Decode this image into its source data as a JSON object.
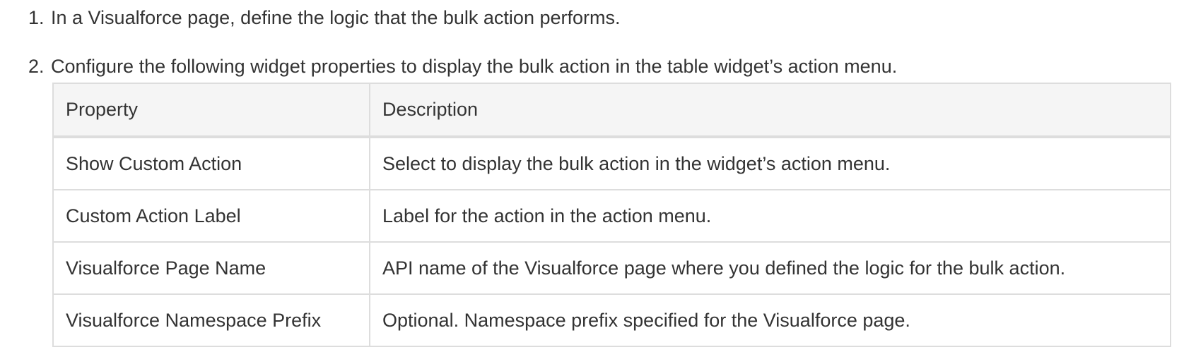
{
  "steps": [
    {
      "number": "1.",
      "text": "In a Visualforce page, define the logic that the bulk action performs."
    },
    {
      "number": "2.",
      "text": "Configure the following widget properties to display the bulk action in the table widget’s action menu."
    }
  ],
  "table": {
    "headers": [
      "Property",
      "Description"
    ],
    "rows": [
      {
        "property": "Show Custom Action",
        "description": "Select to display the bulk action in the widget’s action menu."
      },
      {
        "property": "Custom Action Label",
        "description": "Label for the action in the action menu."
      },
      {
        "property": "Visualforce Page Name",
        "description": "API name of the Visualforce page where you defined the logic for the bulk action."
      },
      {
        "property": "Visualforce Namespace Prefix",
        "description": "Optional. Namespace prefix specified for the Visualforce page."
      }
    ]
  }
}
